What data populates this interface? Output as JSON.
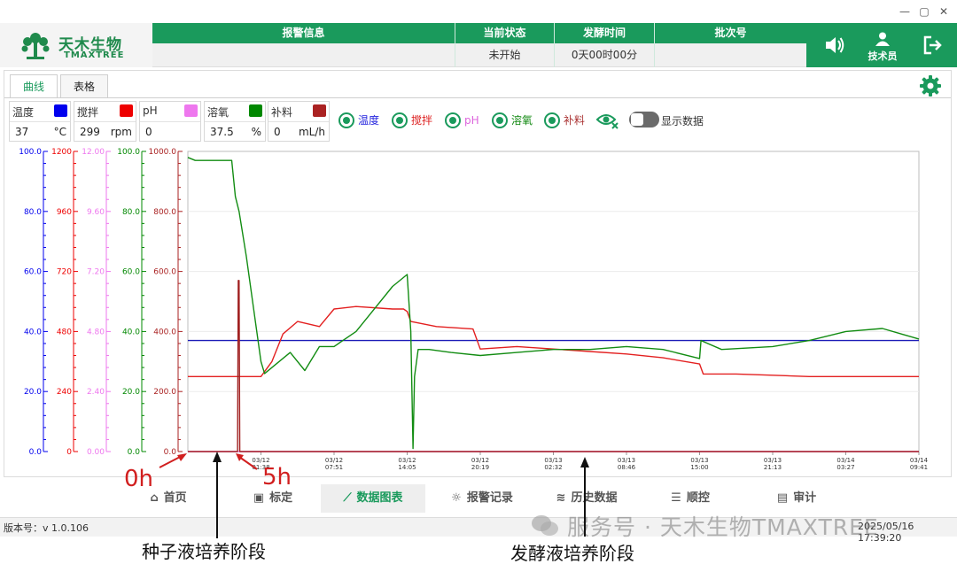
{
  "window": {
    "minimize": "—",
    "maximize": "▢",
    "close": "✕"
  },
  "brand": {
    "name_cn": "天木生物",
    "name_en": "TMAXTREE"
  },
  "header": {
    "alarm_label": "报警信息",
    "alarm_value": "",
    "status_label": "当前状态",
    "status_value": "未开始",
    "time_label": "发酵时间",
    "time_value": "0天00时00分",
    "batch_label": "批次号",
    "batch_value": "",
    "user_label": "技术员"
  },
  "tabs": [
    "曲线",
    "表格"
  ],
  "params": [
    {
      "name": "温度",
      "value": "37",
      "unit": "°C",
      "color": "#0000ee"
    },
    {
      "name": "搅拌",
      "value": "299",
      "unit": "rpm",
      "color": "#ee0000"
    },
    {
      "name": "pH",
      "value": "0",
      "unit": "",
      "color": "#ee77ee"
    },
    {
      "name": "溶氧",
      "value": "37.5",
      "unit": "%",
      "color": "#008800"
    },
    {
      "name": "补料",
      "value": "0",
      "unit": "mL/h",
      "color": "#aa2222"
    }
  ],
  "toggles": [
    {
      "label": "温度",
      "color": "#2222dd"
    },
    {
      "label": "搅拌",
      "color": "#dd2222"
    },
    {
      "label": "pH",
      "color": "#dd66dd"
    },
    {
      "label": "溶氧",
      "color": "#118811"
    },
    {
      "label": "补料",
      "color": "#aa3333"
    }
  ],
  "show_data_label": "显示数据",
  "chart_data": {
    "type": "line",
    "grid": true,
    "axes": [
      {
        "name": "温度",
        "color": "#0000ee",
        "ylim": [
          0,
          100
        ],
        "ticks": [
          "0.0",
          "20.0",
          "40.0",
          "60.0",
          "80.0",
          "100.0"
        ]
      },
      {
        "name": "搅拌",
        "color": "#ee0000",
        "ylim": [
          0,
          1200
        ],
        "ticks": [
          "0",
          "240",
          "480",
          "720",
          "960",
          "1200"
        ]
      },
      {
        "name": "pH",
        "color": "#ee77ee",
        "ylim": [
          0,
          12
        ],
        "ticks": [
          "0.00",
          "2.40",
          "4.80",
          "7.20",
          "9.60",
          "12.00"
        ]
      },
      {
        "name": "溶氧",
        "color": "#008800",
        "ylim": [
          0,
          100
        ],
        "ticks": [
          "0.0",
          "20.0",
          "40.0",
          "60.0",
          "80.0",
          "100.0"
        ]
      },
      {
        "name": "补料",
        "color": "#aa2222",
        "ylim": [
          0,
          1000
        ],
        "ticks": [
          "0.0",
          "200.0",
          "400.0",
          "600.0",
          "800.0",
          "1000.0"
        ]
      }
    ],
    "x_ticks": [
      {
        "date": "03/12",
        "time": "01:38"
      },
      {
        "date": "03/12",
        "time": "07:51"
      },
      {
        "date": "03/12",
        "time": "14:05"
      },
      {
        "date": "03/12",
        "time": "20:19"
      },
      {
        "date": "03/13",
        "time": "02:32"
      },
      {
        "date": "03/13",
        "time": "08:46"
      },
      {
        "date": "03/13",
        "time": "15:00"
      },
      {
        "date": "03/13",
        "time": "21:13"
      },
      {
        "date": "03/14",
        "time": "03:27"
      },
      {
        "date": "03/14",
        "time": "09:41"
      }
    ],
    "series": [
      {
        "name": "温度",
        "color": "#1c1cb8",
        "axis": 0,
        "x": [
          0,
          1,
          2,
          3,
          4,
          5,
          6,
          7,
          8,
          9,
          10
        ],
        "y": [
          37,
          37,
          37,
          37,
          37,
          37,
          37,
          37,
          37,
          37,
          37
        ]
      },
      {
        "name": "搅拌",
        "color": "#e32020",
        "axis": 1,
        "x": [
          0,
          0.9,
          1.0,
          1.15,
          1.3,
          1.5,
          1.8,
          2.0,
          2.3,
          2.8,
          2.95,
          3.0,
          3.05,
          3.4,
          3.9,
          4.0,
          4.5,
          5.0,
          5.5,
          6.0,
          6.5,
          7.0,
          7.05,
          7.5,
          8.0,
          8.5,
          9.0,
          10.0
        ],
        "y": [
          300,
          300,
          300,
          360,
          470,
          520,
          500,
          570,
          580,
          570,
          570,
          560,
          520,
          500,
          490,
          410,
          420,
          410,
          400,
          390,
          375,
          350,
          310,
          310,
          305,
          300,
          300,
          300
        ]
      },
      {
        "name": "pH",
        "color": "#ee77ee",
        "axis": 2,
        "x": [
          0,
          10
        ],
        "y": [
          0,
          0
        ]
      },
      {
        "name": "溶氧",
        "color": "#128c12",
        "axis": 3,
        "x": [
          0,
          0.1,
          0.3,
          0.6,
          0.65,
          0.7,
          0.8,
          1.0,
          1.05,
          1.15,
          1.4,
          1.6,
          1.8,
          2.0,
          2.3,
          2.5,
          2.8,
          3.0,
          3.05,
          3.08,
          3.1,
          3.15,
          3.3,
          3.6,
          4.0,
          4.5,
          5.0,
          5.5,
          6.0,
          6.5,
          7.0,
          7.02,
          7.3,
          8.0,
          8.5,
          9.0,
          9.5,
          10.0
        ],
        "y": [
          98,
          97,
          97,
          97,
          85,
          80,
          65,
          30,
          26,
          28,
          33,
          27,
          35,
          35,
          40,
          46,
          55,
          59,
          40,
          1,
          25,
          34,
          34,
          33,
          32,
          33,
          34,
          34,
          35,
          34,
          31,
          37,
          34,
          35,
          37,
          40,
          41,
          37.5
        ]
      },
      {
        "name": "补料",
        "color": "#a02020",
        "axis": 4,
        "x": [
          0,
          0.68,
          0.69,
          0.7,
          0.71,
          10
        ],
        "y": [
          0,
          0,
          570,
          570,
          0,
          0
        ]
      }
    ]
  },
  "annotations": {
    "start_label": "0h",
    "five_h_label": "5h",
    "seed_stage": "种子液培养阶段",
    "ferment_stage": "发酵液培养阶段"
  },
  "nav": [
    {
      "label": "首页",
      "icon": "⌂"
    },
    {
      "label": "标定",
      "icon": "▣"
    },
    {
      "label": "数据图表",
      "icon": "⟋"
    },
    {
      "label": "报警记录",
      "icon": "☼"
    },
    {
      "label": "历史数据",
      "icon": "≋"
    },
    {
      "label": "顺控",
      "icon": "☰"
    },
    {
      "label": "审计",
      "icon": "▤"
    }
  ],
  "status": {
    "version": "版本号：v 1.0.106",
    "datetime": "2025/05/16 17:39:20"
  },
  "watermark": "服务号 · 天木生物TMAXTREE"
}
